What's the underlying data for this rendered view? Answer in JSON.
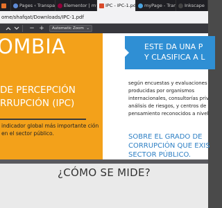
{
  "browser": {
    "tabs": [
      {
        "label": "o",
        "color": "#e6712a"
      },
      {
        "label": "Pages ‹ Transpare",
        "color": "#5f8bd6"
      },
      {
        "label": "Elementor | mySit",
        "color": "#92003b"
      },
      {
        "label": "IPC - IPC-1.pdf",
        "color": "#d94b2b",
        "active": true
      },
      {
        "label": "myPage - Transp",
        "color": "#4aa3df"
      },
      {
        "label": "Inkscape",
        "color": "#444444"
      }
    ],
    "close_glyph": "×",
    "url": "ome/shafqat/Downloads/IPC-1.pdf"
  },
  "pdf_toolbar": {
    "prev_icon": "chevron-up-icon",
    "next_icon": "chevron-down-icon",
    "zoom_out": "−",
    "zoom_in": "+",
    "zoom_value": "Automatic Zoom",
    "zoom_caret": "⌄"
  },
  "document": {
    "big_title": "OMBIA",
    "subtitle_line1": "DE PERCEPCIÓN",
    "subtitle_line2": "RRUPCIÓN (IPC)",
    "left_text": "indicador global más importante ción en el sector público.",
    "banner_line1": "ESTE DA UNA P",
    "banner_line2": "Y CLASIFICA A L",
    "right_text": "según encuestas y evaluaciones producidas por  organismos internacionales, consultorías priv análisis de riesgos, y centros de pensamiento reconocidos a nivel",
    "right_heading_line1": "SOBRE EL GRADO DE",
    "right_heading_line2": "CORRUPCIÓN QUE EXIS",
    "right_heading_line3": "SECTOR PÚBLICO.",
    "lower_title": "¿CÓMO SE MIDE?"
  },
  "colors": {
    "orange": "#f3a11a",
    "blue": "#2f8fd4",
    "heading_blue": "#2d7fc4"
  }
}
